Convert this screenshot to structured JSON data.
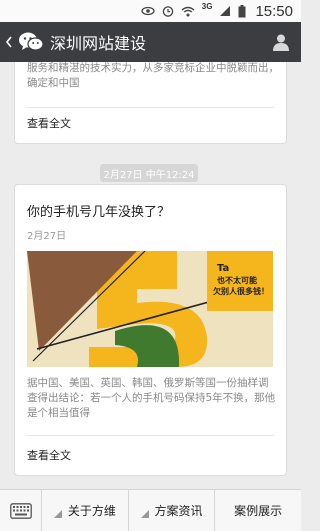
{
  "status_bar": {
    "time": "15:50",
    "network": "3G",
    "icons": [
      "eye-icon",
      "alarm-icon",
      "wifi-icon",
      "signal-icon",
      "battery-icon"
    ]
  },
  "header": {
    "title": "深圳网站建设",
    "back_icon": "back-chevron-icon",
    "logo_icon": "wechat-icon",
    "user_icon": "user-profile-icon"
  },
  "feed": {
    "card1": {
      "excerpt": "服务和精湛的技术实力，从多家竞标企业中脱颖而出，确定和中国",
      "read_more": "查看全文"
    },
    "timestamp": "2月27日 中午12:24",
    "card2": {
      "title": "你的手机号几年没换了？",
      "date": "2月27日",
      "cover_text_line1": "Ta",
      "cover_text_line2": "也不太可能",
      "cover_text_line3": "欠别人很多钱！",
      "summary": "据中国、美国、英国、韩国、俄罗斯等国一份抽样调查得出结论：若一个人的手机号码保持5年不换，那他是个相当值得",
      "read_more": "查看全文"
    }
  },
  "bottom_nav": {
    "keyboard_icon": "keyboard-icon",
    "items": [
      {
        "label": "关于方维",
        "has_submenu": true
      },
      {
        "label": "方案资讯",
        "has_submenu": true
      },
      {
        "label": "案例展示",
        "has_submenu": false
      }
    ]
  },
  "colors": {
    "header_bg": "#3b3d41",
    "page_bg": "#ececec",
    "cover_orange": "#f5b51c",
    "cover_brown": "#8a5a3c",
    "cover_green": "#3f7a2f"
  }
}
